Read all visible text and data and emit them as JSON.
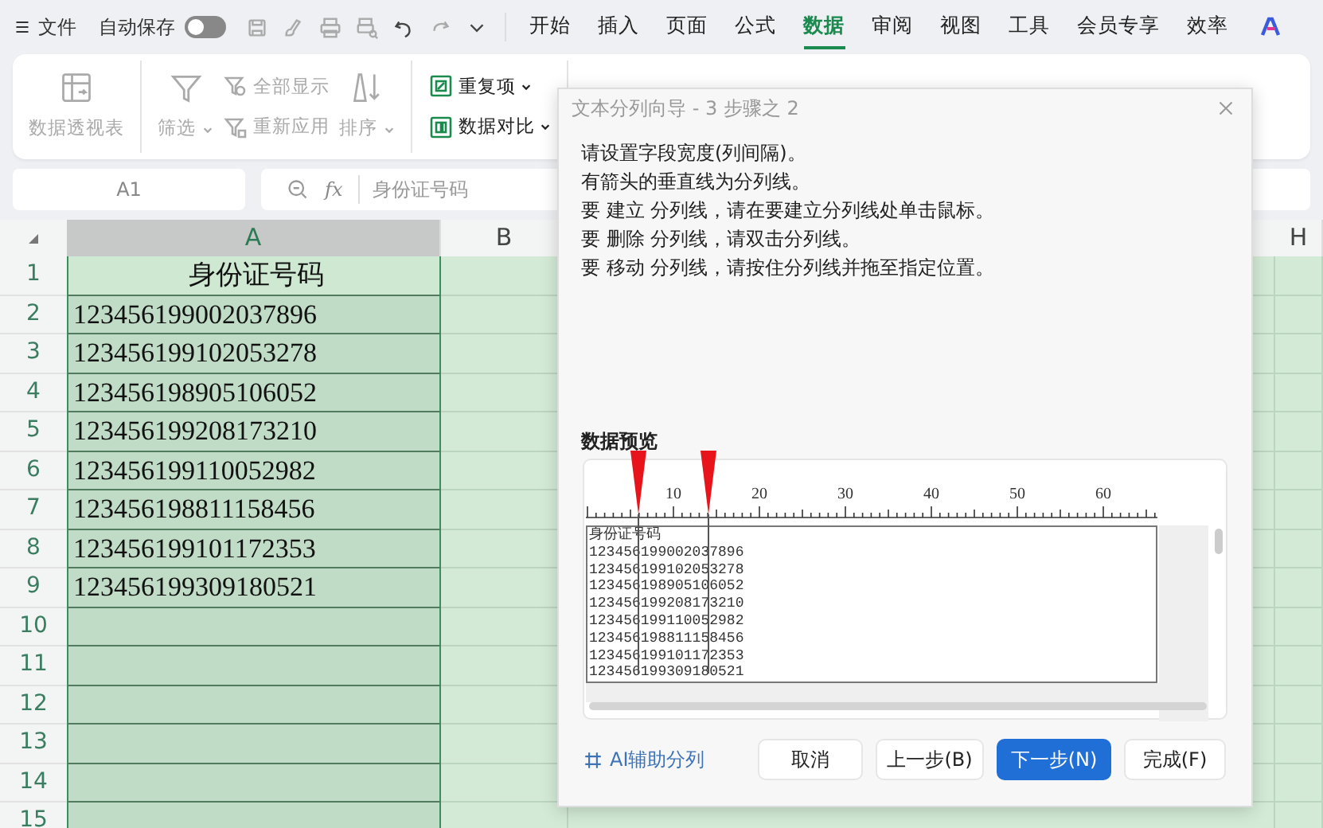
{
  "menu": {
    "file": "文件",
    "autosave": {
      "label": "自动保存",
      "on": false
    }
  },
  "tabs": [
    {
      "label": "开始",
      "selected": false
    },
    {
      "label": "插入",
      "selected": false
    },
    {
      "label": "页面",
      "selected": false
    },
    {
      "label": "公式",
      "selected": false
    },
    {
      "label": "数据",
      "selected": true
    },
    {
      "label": "审阅",
      "selected": false
    },
    {
      "label": "视图",
      "selected": false
    },
    {
      "label": "工具",
      "selected": false
    },
    {
      "label": "会员专享",
      "selected": false
    },
    {
      "label": "效率",
      "selected": false
    }
  ],
  "ribbon": {
    "groups": [
      {
        "items": [
          {
            "kind": "large",
            "label": "数据透视表",
            "dropdown": false,
            "disabled": true
          }
        ]
      },
      {
        "items": [
          {
            "kind": "large",
            "label": "筛选",
            "dropdown": true,
            "disabled": true
          },
          {
            "kind": "small",
            "label": "全部显示",
            "dropdown": false,
            "disabled": true
          },
          {
            "kind": "small",
            "label": "重新应用",
            "dropdown": false,
            "disabled": true
          },
          {
            "kind": "large",
            "label": "排序",
            "dropdown": true,
            "disabled": true
          }
        ]
      },
      {
        "items": [
          {
            "kind": "small",
            "label": "重复项",
            "dropdown": true,
            "disabled": false
          },
          {
            "kind": "small",
            "label": "数据对比",
            "dropdown": true,
            "disabled": false
          }
        ]
      }
    ]
  },
  "formula_bar": {
    "cell_ref": "A1",
    "function_label": "fx",
    "formula": "身份证号码"
  },
  "sheet": {
    "columns": [
      {
        "label": "A",
        "selected": true
      },
      {
        "label": "B",
        "selected": false
      },
      {
        "label": "H",
        "selected": false
      }
    ],
    "rows": [
      {
        "label": "1",
        "cells": [
          "身份证号码"
        ]
      },
      {
        "label": "2",
        "cells": [
          "123456199002037896"
        ]
      },
      {
        "label": "3",
        "cells": [
          "123456199102053278"
        ]
      },
      {
        "label": "4",
        "cells": [
          "123456198905106052"
        ]
      },
      {
        "label": "5",
        "cells": [
          "123456199208173210"
        ]
      },
      {
        "label": "6",
        "cells": [
          "123456199110052982"
        ]
      },
      {
        "label": "7",
        "cells": [
          "123456198811158456"
        ]
      },
      {
        "label": "8",
        "cells": [
          "123456199101172353"
        ]
      },
      {
        "label": "9",
        "cells": [
          "123456199309180521"
        ]
      },
      {
        "label": "10",
        "cells": []
      },
      {
        "label": "11",
        "cells": []
      },
      {
        "label": "12",
        "cells": []
      },
      {
        "label": "13",
        "cells": []
      },
      {
        "label": "14",
        "cells": []
      },
      {
        "label": "15",
        "cells": []
      }
    ]
  },
  "dialog": {
    "title": "文本分列向导 - 3 步骤之 2",
    "instructions": [
      "请设置字段宽度(列间隔)。",
      "有箭头的垂直线为分列线。",
      "要 建立 分列线，请在要建立分列线处单击鼠标。",
      "要 删除 分列线，请双击分列线。",
      "要 移动 分列线，请按住分列线并拖至指定位置。"
    ],
    "preview": {
      "heading": "数据预览",
      "ruler": [
        "10",
        "20",
        "30",
        "40",
        "50",
        "60"
      ],
      "rows": [
        [
          "身份证号码"
        ],
        [
          "123456",
          "19900203",
          "7896"
        ],
        [
          "123456",
          "19910205",
          "3278"
        ],
        [
          "123456",
          "19890510",
          "6052"
        ],
        [
          "123456",
          "19920817",
          "3210"
        ],
        [
          "123456",
          "19911005",
          "2982"
        ],
        [
          "123456",
          "19881115",
          "8456"
        ],
        [
          "123456",
          "19910117",
          "2353"
        ],
        [
          "123456",
          "19930918",
          "0521"
        ]
      ]
    },
    "ai_link": "AI辅助分列",
    "buttons": [
      {
        "label": "取消",
        "primary": false
      },
      {
        "label": "上一步(B)",
        "primary": false
      },
      {
        "label": "下一步(N)",
        "primary": true
      },
      {
        "label": "完成(F)",
        "primary": false
      }
    ]
  }
}
